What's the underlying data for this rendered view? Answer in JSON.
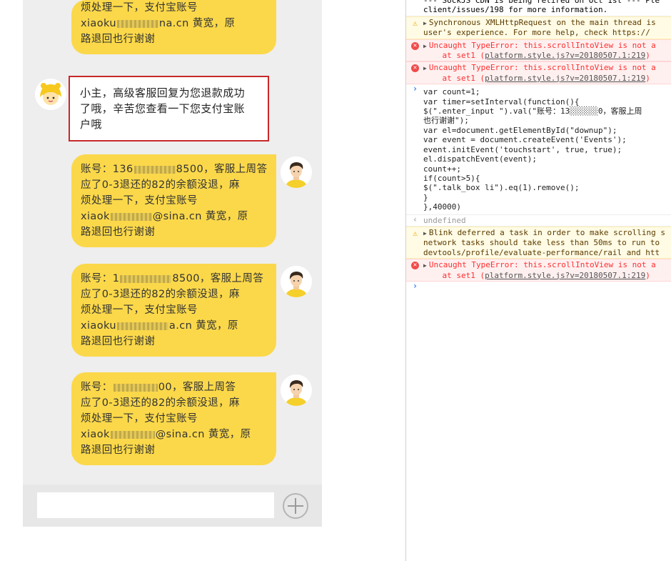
{
  "chat": {
    "messages": [
      {
        "id": "m0",
        "side": "right",
        "lines": [
          [
            "烦处理一下，支付宝账号"
          ],
          [
            "xiaoku",
            "#m",
            "na.cn 黄宽，原"
          ],
          [
            "路退回也行谢谢"
          ]
        ]
      },
      {
        "id": "m1",
        "side": "left",
        "lines": [
          [
            "小主，高级客服回复为您退款成功"
          ],
          [
            "了哦，辛苦您查看一下您支付宝账"
          ],
          [
            "户哦"
          ]
        ]
      },
      {
        "id": "m2",
        "side": "right",
        "lines": [
          [
            "账号：136",
            "#m",
            "8500，客服上周答"
          ],
          [
            "应了0-3退还的82的余额没退，麻"
          ],
          [
            "烦处理一下，支付宝账号"
          ],
          [
            "xiaok",
            "#m",
            "@sina.cn 黄宽，原"
          ],
          [
            "路退回也行谢谢"
          ]
        ]
      },
      {
        "id": "m3",
        "side": "right",
        "lines": [
          [
            "账号：1",
            "#m",
            "8500，客服上周答"
          ],
          [
            "应了0-3退还的82的余额没退，麻"
          ],
          [
            "烦处理一下，支付宝账号"
          ],
          [
            "xiaoku",
            "#m",
            "a.cn 黄宽，原"
          ],
          [
            "路退回也行谢谢"
          ]
        ]
      },
      {
        "id": "m4",
        "side": "right",
        "lines": [
          [
            "账号：",
            "#m",
            "00，客服上周答"
          ],
          [
            "应了0-3退还的82的余额没退，麻"
          ],
          [
            "烦处理一下，支付宝账号"
          ],
          [
            "xiaok",
            "#m",
            "@sina.cn 黄宽，原"
          ],
          [
            "路退回也行谢谢"
          ]
        ]
      }
    ],
    "input": {
      "value": "",
      "placeholder": ""
    },
    "add_button_icon": "plus-circle-icon"
  },
  "console": {
    "rows": [
      {
        "type": "info",
        "icon": "",
        "text": "--- SockJS CDN is being retired on Oct 1st --- Ple\nclient/issues/198 for more information."
      },
      {
        "type": "warn",
        "icon": "warning-icon",
        "text": "Synchronous XMLHttpRequest on the main thread is\nuser's experience. For more help, check https://"
      },
      {
        "type": "err",
        "icon": "error-icon",
        "text": "Uncaught TypeError: this.scrollIntoView is not a\n    at set1 (",
        "link": "platform.style.js?v=20180507.1:219",
        "after": ")"
      },
      {
        "type": "err",
        "icon": "error-icon",
        "text": "Uncaught TypeError: this.scrollIntoView is not a\n    at set1 (",
        "link": "platform.style.js?v=20180507.1:219",
        "after": ")"
      },
      {
        "type": "input",
        "icon": "prompt-icon",
        "text": "var count=1;\nvar timer=setInterval(function(){\n$(\".enter_input \").val(\"账号：13░░░░░░0，客服上周\n也行谢谢\");\nvar el=document.getElementById(\"downup\");\nvar event = document.createEvent('Events');\nevent.initEvent('touchstart', true, true);\nel.dispatchEvent(event);\ncount++;\nif(count>5){\n$(\".talk_box li\").eq(1).remove();\n}\n},40000)"
      },
      {
        "type": "result",
        "icon": "return-icon",
        "text": "undefined"
      },
      {
        "type": "warn",
        "icon": "warning-icon",
        "text": "Blink deferred a task in order to make scrolling s\nnetwork tasks should take less than 50ms to run to\ndevtools/profile/evaluate-performance/rail and htt"
      },
      {
        "type": "err",
        "icon": "error-icon",
        "text": "Uncaught TypeError: this.scrollIntoView is not a\n    at set1 (",
        "link": "platform.style.js?v=20180507.1:219",
        "after": ")"
      },
      {
        "type": "prompt",
        "icon": "prompt-icon",
        "text": ""
      }
    ]
  },
  "colors": {
    "bubble": "#fbd84a",
    "chat_bg": "#eeeeee",
    "highlight_border": "#c8282a",
    "error": "#fe2f2f",
    "warning_bg": "#fffbe5"
  }
}
